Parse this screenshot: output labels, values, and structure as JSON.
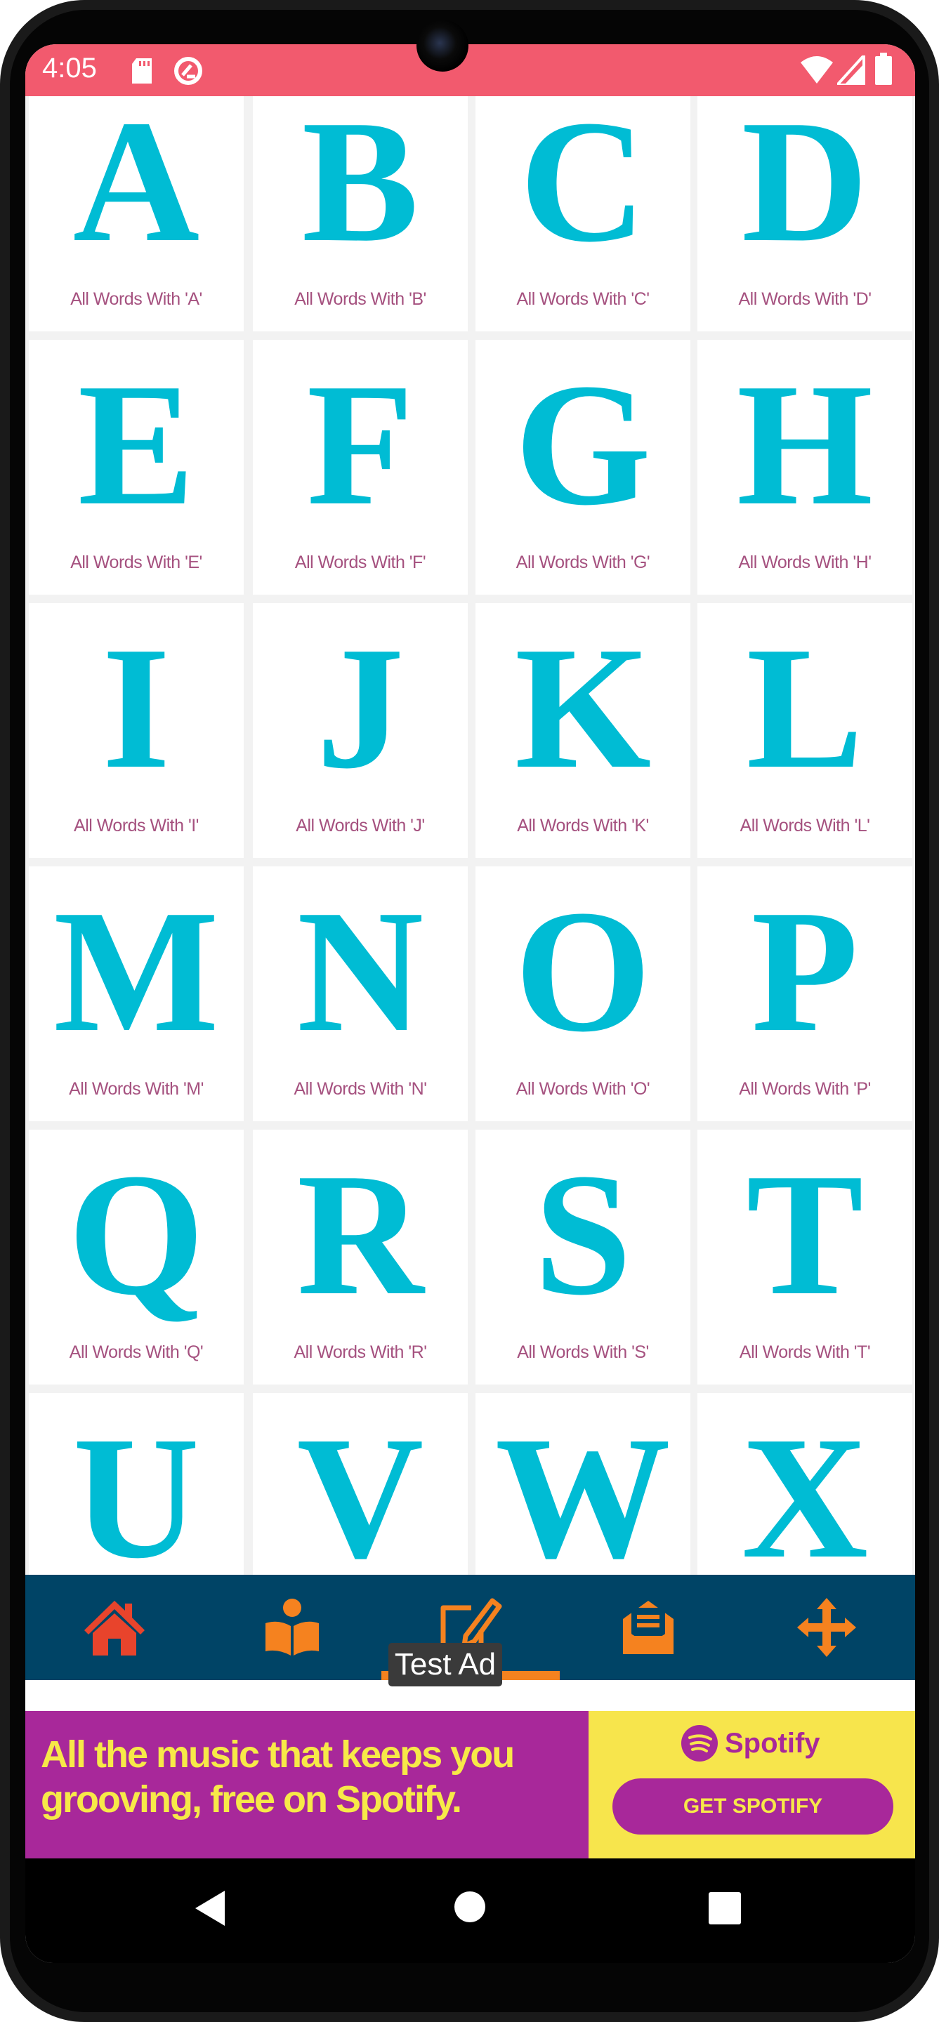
{
  "status_bar": {
    "time": "4:05",
    "left_icons": [
      "sd-card-icon",
      "data-saver-icon"
    ],
    "right_icons": [
      "wifi-icon",
      "signal-icon",
      "battery-icon"
    ],
    "color": "#f25a6e"
  },
  "letters": [
    {
      "letter": "A",
      "caption": "All Words With 'A'"
    },
    {
      "letter": "B",
      "caption": "All Words With 'B'"
    },
    {
      "letter": "C",
      "caption": "All Words With 'C'"
    },
    {
      "letter": "D",
      "caption": "All Words With 'D'"
    },
    {
      "letter": "E",
      "caption": "All Words With 'E'"
    },
    {
      "letter": "F",
      "caption": "All Words With 'F'"
    },
    {
      "letter": "G",
      "caption": "All Words With 'G'"
    },
    {
      "letter": "H",
      "caption": "All Words With 'H'"
    },
    {
      "letter": "I",
      "caption": "All Words With 'I'"
    },
    {
      "letter": "J",
      "caption": "All Words With 'J'"
    },
    {
      "letter": "K",
      "caption": "All Words With 'K'"
    },
    {
      "letter": "L",
      "caption": "All Words With 'L'"
    },
    {
      "letter": "M",
      "caption": "All Words With 'M'"
    },
    {
      "letter": "N",
      "caption": "All Words With 'N'"
    },
    {
      "letter": "O",
      "caption": "All Words With 'O'"
    },
    {
      "letter": "P",
      "caption": "All Words With 'P'"
    },
    {
      "letter": "Q",
      "caption": "All Words With 'Q'"
    },
    {
      "letter": "R",
      "caption": "All Words With 'R'"
    },
    {
      "letter": "S",
      "caption": "All Words With 'S'"
    },
    {
      "letter": "T",
      "caption": "All Words With 'T'"
    },
    {
      "letter": "U",
      "caption": ""
    },
    {
      "letter": "V",
      "caption": ""
    },
    {
      "letter": "W",
      "caption": ""
    },
    {
      "letter": "X",
      "caption": ""
    }
  ],
  "colors": {
    "letter": "#00bcd4",
    "caption": "#a5517f",
    "nav_bg": "#004466",
    "nav_accent": "#f5821f",
    "home_icon": "#e8442c"
  },
  "bottom_nav": {
    "items": [
      "home-icon",
      "reader-icon",
      "edit-icon",
      "mail-icon",
      "move-icon"
    ],
    "selected": "edit-icon"
  },
  "ad": {
    "badge": "Test Ad",
    "headline_line1": "All the music that keeps you",
    "headline_line2": "grooving, free on Spotify.",
    "brand": "Spotify",
    "cta": "GET SPOTIFY"
  },
  "system_nav": [
    "back-icon",
    "home-circle-icon",
    "recents-icon"
  ]
}
